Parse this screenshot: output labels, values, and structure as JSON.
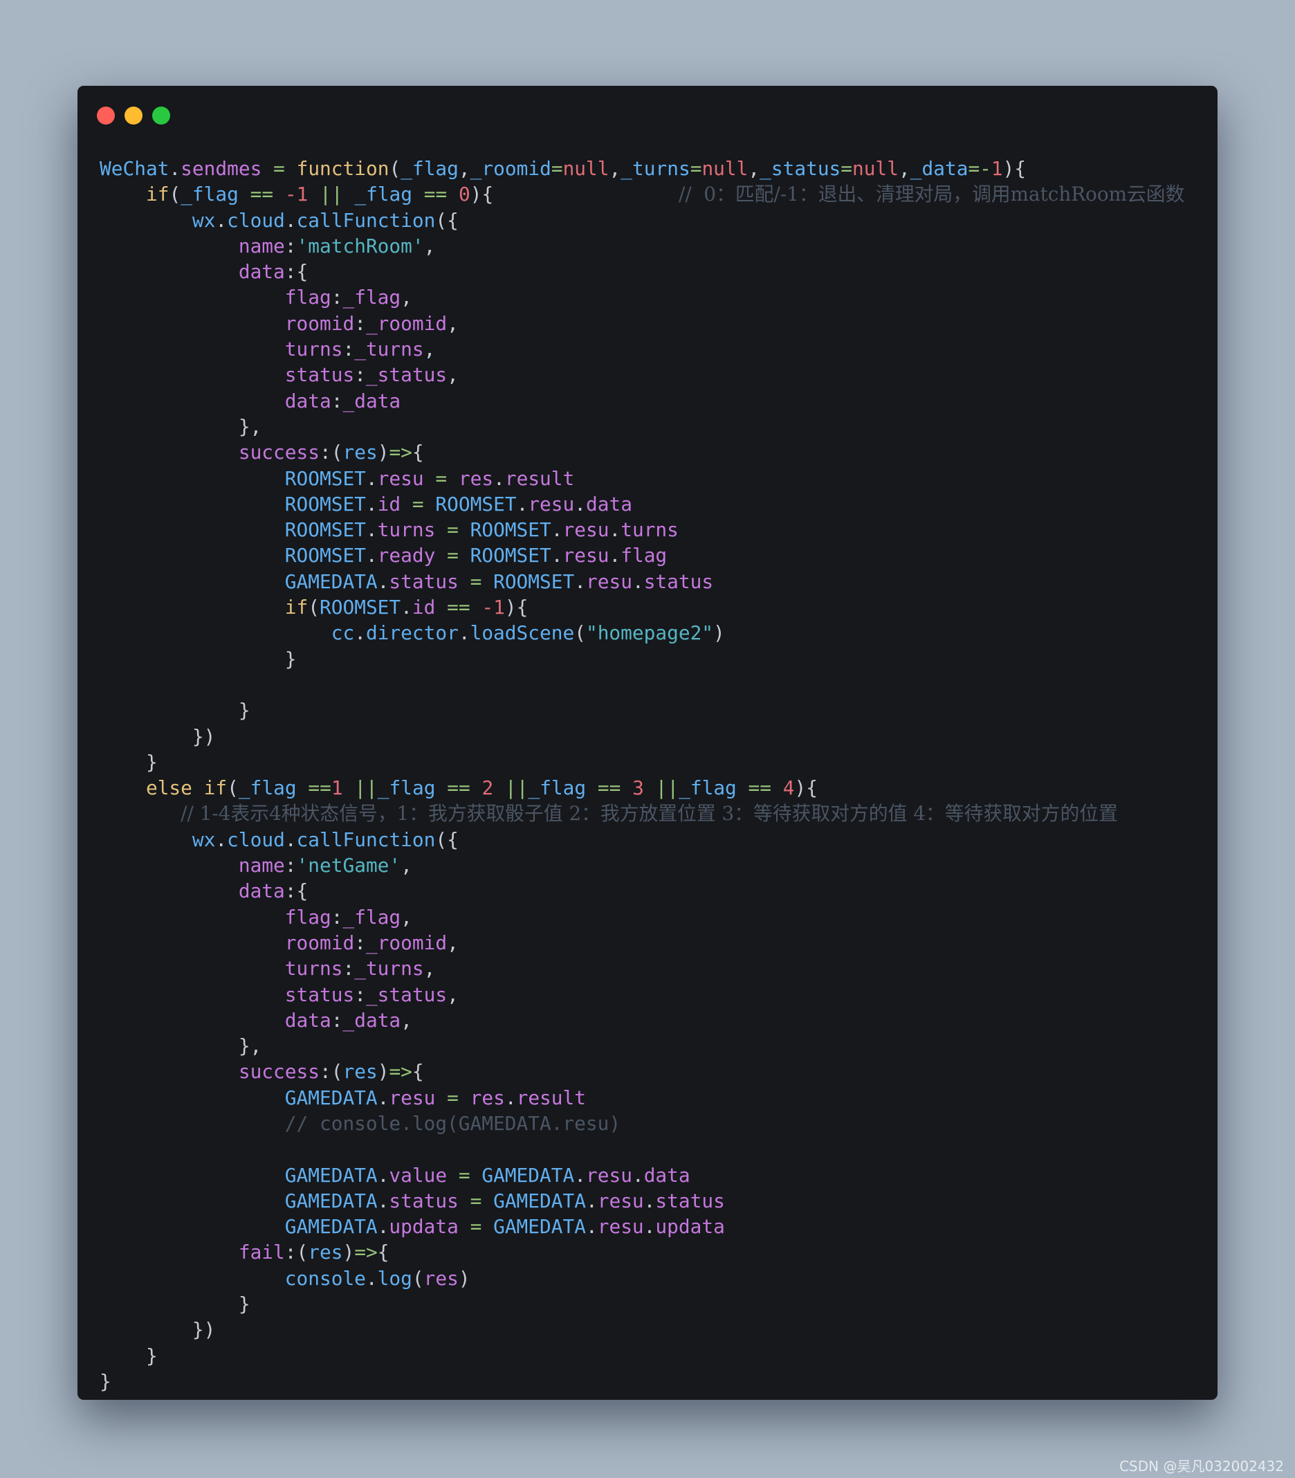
{
  "window": {
    "traffic_lights": [
      {
        "name": "close",
        "color": "#fe5f57"
      },
      {
        "name": "minimize",
        "color": "#febc2e"
      },
      {
        "name": "maximize",
        "color": "#28c840"
      }
    ]
  },
  "colors": {
    "background": "#a8b5c3",
    "window": "#16181c",
    "default": "#c8ccd4",
    "keyword": "#e5c07b",
    "func": "#e5c07b",
    "ident": "#61afef",
    "prop": "#c678dd",
    "number": "#e06c75",
    "string": "#56b6c2",
    "op": "#98c379",
    "comment": "#4b5563"
  },
  "code_lines": [
    [
      [
        "ident",
        "WeChat"
      ],
      [
        "text",
        "."
      ],
      [
        "prop",
        "sendmes"
      ],
      [
        "text",
        " "
      ],
      [
        "op",
        "="
      ],
      [
        "text",
        " "
      ],
      [
        "func",
        "function"
      ],
      [
        "text",
        "("
      ],
      [
        "ident",
        "_flag"
      ],
      [
        "text",
        ","
      ],
      [
        "ident",
        "_roomid"
      ],
      [
        "op",
        "="
      ],
      [
        "number",
        "null"
      ],
      [
        "text",
        ","
      ],
      [
        "ident",
        "_turns"
      ],
      [
        "op",
        "="
      ],
      [
        "number",
        "null"
      ],
      [
        "text",
        ","
      ],
      [
        "ident",
        "_status"
      ],
      [
        "op",
        "="
      ],
      [
        "number",
        "null"
      ],
      [
        "text",
        ","
      ],
      [
        "ident",
        "_data"
      ],
      [
        "op",
        "=-"
      ],
      [
        "number",
        "1"
      ],
      [
        "text",
        "){"
      ]
    ],
    [
      [
        "text",
        "    "
      ],
      [
        "keyword",
        "if"
      ],
      [
        "text",
        "("
      ],
      [
        "ident",
        "_flag"
      ],
      [
        "text",
        " "
      ],
      [
        "op",
        "=="
      ],
      [
        "text",
        " "
      ],
      [
        "number",
        "-1"
      ],
      [
        "text",
        " "
      ],
      [
        "op",
        "||"
      ],
      [
        "text",
        " "
      ],
      [
        "ident",
        "_flag"
      ],
      [
        "text",
        " "
      ],
      [
        "op",
        "=="
      ],
      [
        "text",
        " "
      ],
      [
        "number",
        "0"
      ],
      [
        "text",
        "){                "
      ],
      [
        "comment",
        "//  0：匹配/-1：退出、清理对局，调用matchRoom云函数"
      ]
    ],
    [
      [
        "text",
        "        "
      ],
      [
        "ident",
        "wx"
      ],
      [
        "text",
        "."
      ],
      [
        "ident",
        "cloud"
      ],
      [
        "text",
        "."
      ],
      [
        "ident",
        "callFunction"
      ],
      [
        "text",
        "({"
      ]
    ],
    [
      [
        "text",
        "            "
      ],
      [
        "prop",
        "name"
      ],
      [
        "text",
        ":"
      ],
      [
        "string",
        "'matchRoom'"
      ],
      [
        "text",
        ","
      ]
    ],
    [
      [
        "text",
        "            "
      ],
      [
        "prop",
        "data"
      ],
      [
        "text",
        ":{"
      ]
    ],
    [
      [
        "text",
        "                "
      ],
      [
        "prop",
        "flag"
      ],
      [
        "text",
        ":"
      ],
      [
        "prop",
        "_flag"
      ],
      [
        "text",
        ","
      ]
    ],
    [
      [
        "text",
        "                "
      ],
      [
        "prop",
        "roomid"
      ],
      [
        "text",
        ":"
      ],
      [
        "prop",
        "_roomid"
      ],
      [
        "text",
        ","
      ]
    ],
    [
      [
        "text",
        "                "
      ],
      [
        "prop",
        "turns"
      ],
      [
        "text",
        ":"
      ],
      [
        "prop",
        "_turns"
      ],
      [
        "text",
        ","
      ]
    ],
    [
      [
        "text",
        "                "
      ],
      [
        "prop",
        "status"
      ],
      [
        "text",
        ":"
      ],
      [
        "prop",
        "_status"
      ],
      [
        "text",
        ","
      ]
    ],
    [
      [
        "text",
        "                "
      ],
      [
        "prop",
        "data"
      ],
      [
        "text",
        ":"
      ],
      [
        "prop",
        "_data"
      ]
    ],
    [
      [
        "text",
        "            },"
      ]
    ],
    [
      [
        "text",
        "            "
      ],
      [
        "prop",
        "success"
      ],
      [
        "text",
        ":("
      ],
      [
        "ident",
        "res"
      ],
      [
        "text",
        ")"
      ],
      [
        "op",
        "=>"
      ],
      [
        "text",
        "{"
      ]
    ],
    [
      [
        "text",
        "                "
      ],
      [
        "ident",
        "ROOMSET"
      ],
      [
        "text",
        "."
      ],
      [
        "prop",
        "resu"
      ],
      [
        "text",
        " "
      ],
      [
        "op",
        "="
      ],
      [
        "text",
        " "
      ],
      [
        "prop",
        "res"
      ],
      [
        "text",
        "."
      ],
      [
        "prop",
        "result"
      ]
    ],
    [
      [
        "text",
        "                "
      ],
      [
        "ident",
        "ROOMSET"
      ],
      [
        "text",
        "."
      ],
      [
        "prop",
        "id"
      ],
      [
        "text",
        " "
      ],
      [
        "op",
        "="
      ],
      [
        "text",
        " "
      ],
      [
        "ident",
        "ROOMSET"
      ],
      [
        "text",
        "."
      ],
      [
        "prop",
        "resu"
      ],
      [
        "text",
        "."
      ],
      [
        "prop",
        "data"
      ]
    ],
    [
      [
        "text",
        "                "
      ],
      [
        "ident",
        "ROOMSET"
      ],
      [
        "text",
        "."
      ],
      [
        "prop",
        "turns"
      ],
      [
        "text",
        " "
      ],
      [
        "op",
        "="
      ],
      [
        "text",
        " "
      ],
      [
        "ident",
        "ROOMSET"
      ],
      [
        "text",
        "."
      ],
      [
        "prop",
        "resu"
      ],
      [
        "text",
        "."
      ],
      [
        "prop",
        "turns"
      ]
    ],
    [
      [
        "text",
        "                "
      ],
      [
        "ident",
        "ROOMSET"
      ],
      [
        "text",
        "."
      ],
      [
        "prop",
        "ready"
      ],
      [
        "text",
        " "
      ],
      [
        "op",
        "="
      ],
      [
        "text",
        " "
      ],
      [
        "ident",
        "ROOMSET"
      ],
      [
        "text",
        "."
      ],
      [
        "prop",
        "resu"
      ],
      [
        "text",
        "."
      ],
      [
        "prop",
        "flag"
      ]
    ],
    [
      [
        "text",
        "                "
      ],
      [
        "ident",
        "GAMEDATA"
      ],
      [
        "text",
        "."
      ],
      [
        "prop",
        "status"
      ],
      [
        "text",
        " "
      ],
      [
        "op",
        "="
      ],
      [
        "text",
        " "
      ],
      [
        "ident",
        "ROOMSET"
      ],
      [
        "text",
        "."
      ],
      [
        "prop",
        "resu"
      ],
      [
        "text",
        "."
      ],
      [
        "prop",
        "status"
      ]
    ],
    [
      [
        "text",
        "                "
      ],
      [
        "keyword",
        "if"
      ],
      [
        "text",
        "("
      ],
      [
        "ident",
        "ROOMSET"
      ],
      [
        "text",
        "."
      ],
      [
        "prop",
        "id"
      ],
      [
        "text",
        " "
      ],
      [
        "op",
        "=="
      ],
      [
        "text",
        " "
      ],
      [
        "number",
        "-1"
      ],
      [
        "text",
        "){"
      ]
    ],
    [
      [
        "text",
        "                    "
      ],
      [
        "ident",
        "cc"
      ],
      [
        "text",
        "."
      ],
      [
        "ident",
        "director"
      ],
      [
        "text",
        "."
      ],
      [
        "ident",
        "loadScene"
      ],
      [
        "text",
        "("
      ],
      [
        "string",
        "\"homepage2\""
      ],
      [
        "text",
        ")"
      ]
    ],
    [
      [
        "text",
        "                }"
      ]
    ],
    [
      [
        "text",
        ""
      ]
    ],
    [
      [
        "text",
        "            }"
      ]
    ],
    [
      [
        "text",
        "        })"
      ]
    ],
    [
      [
        "text",
        "    }"
      ]
    ],
    [
      [
        "text",
        "    "
      ],
      [
        "keyword",
        "else"
      ],
      [
        "text",
        " "
      ],
      [
        "keyword",
        "if"
      ],
      [
        "text",
        "("
      ],
      [
        "ident",
        "_flag"
      ],
      [
        "text",
        " "
      ],
      [
        "op",
        "=="
      ],
      [
        "number",
        "1"
      ],
      [
        "text",
        " "
      ],
      [
        "op",
        "||"
      ],
      [
        "ident",
        "_flag"
      ],
      [
        "text",
        " "
      ],
      [
        "op",
        "=="
      ],
      [
        "text",
        " "
      ],
      [
        "number",
        "2"
      ],
      [
        "text",
        " "
      ],
      [
        "op",
        "||"
      ],
      [
        "ident",
        "_flag"
      ],
      [
        "text",
        " "
      ],
      [
        "op",
        "=="
      ],
      [
        "text",
        " "
      ],
      [
        "number",
        "3"
      ],
      [
        "text",
        " "
      ],
      [
        "op",
        "||"
      ],
      [
        "ident",
        "_flag"
      ],
      [
        "text",
        " "
      ],
      [
        "op",
        "=="
      ],
      [
        "text",
        " "
      ],
      [
        "number",
        "4"
      ],
      [
        "text",
        "){"
      ]
    ],
    [
      [
        "text",
        "       "
      ],
      [
        "comment",
        "// 1-4表示4种状态信号，1：我方获取骰子值 2：我方放置位置 3：等待获取对方的值 4：等待获取对方的位置"
      ]
    ],
    [
      [
        "text",
        "        "
      ],
      [
        "ident",
        "wx"
      ],
      [
        "text",
        "."
      ],
      [
        "ident",
        "cloud"
      ],
      [
        "text",
        "."
      ],
      [
        "ident",
        "callFunction"
      ],
      [
        "text",
        "({"
      ]
    ],
    [
      [
        "text",
        "            "
      ],
      [
        "prop",
        "name"
      ],
      [
        "text",
        ":"
      ],
      [
        "string",
        "'netGame'"
      ],
      [
        "text",
        ","
      ]
    ],
    [
      [
        "text",
        "            "
      ],
      [
        "prop",
        "data"
      ],
      [
        "text",
        ":{"
      ]
    ],
    [
      [
        "text",
        "                "
      ],
      [
        "prop",
        "flag"
      ],
      [
        "text",
        ":"
      ],
      [
        "prop",
        "_flag"
      ],
      [
        "text",
        ","
      ]
    ],
    [
      [
        "text",
        "                "
      ],
      [
        "prop",
        "roomid"
      ],
      [
        "text",
        ":"
      ],
      [
        "prop",
        "_roomid"
      ],
      [
        "text",
        ","
      ]
    ],
    [
      [
        "text",
        "                "
      ],
      [
        "prop",
        "turns"
      ],
      [
        "text",
        ":"
      ],
      [
        "prop",
        "_turns"
      ],
      [
        "text",
        ","
      ]
    ],
    [
      [
        "text",
        "                "
      ],
      [
        "prop",
        "status"
      ],
      [
        "text",
        ":"
      ],
      [
        "prop",
        "_status"
      ],
      [
        "text",
        ","
      ]
    ],
    [
      [
        "text",
        "                "
      ],
      [
        "prop",
        "data"
      ],
      [
        "text",
        ":"
      ],
      [
        "prop",
        "_data"
      ],
      [
        "text",
        ","
      ]
    ],
    [
      [
        "text",
        "            },"
      ]
    ],
    [
      [
        "text",
        "            "
      ],
      [
        "prop",
        "success"
      ],
      [
        "text",
        ":("
      ],
      [
        "ident",
        "res"
      ],
      [
        "text",
        ")"
      ],
      [
        "op",
        "=>"
      ],
      [
        "text",
        "{"
      ]
    ],
    [
      [
        "text",
        "                "
      ],
      [
        "ident",
        "GAMEDATA"
      ],
      [
        "text",
        "."
      ],
      [
        "prop",
        "resu"
      ],
      [
        "text",
        " "
      ],
      [
        "op",
        "="
      ],
      [
        "text",
        " "
      ],
      [
        "prop",
        "res"
      ],
      [
        "text",
        "."
      ],
      [
        "prop",
        "result"
      ]
    ],
    [
      [
        "text",
        "                "
      ],
      [
        "comment",
        "// console.log(GAMEDATA.resu)"
      ]
    ],
    [
      [
        "text",
        ""
      ]
    ],
    [
      [
        "text",
        "                "
      ],
      [
        "ident",
        "GAMEDATA"
      ],
      [
        "text",
        "."
      ],
      [
        "prop",
        "value"
      ],
      [
        "text",
        " "
      ],
      [
        "op",
        "="
      ],
      [
        "text",
        " "
      ],
      [
        "ident",
        "GAMEDATA"
      ],
      [
        "text",
        "."
      ],
      [
        "prop",
        "resu"
      ],
      [
        "text",
        "."
      ],
      [
        "prop",
        "data"
      ]
    ],
    [
      [
        "text",
        "                "
      ],
      [
        "ident",
        "GAMEDATA"
      ],
      [
        "text",
        "."
      ],
      [
        "prop",
        "status"
      ],
      [
        "text",
        " "
      ],
      [
        "op",
        "="
      ],
      [
        "text",
        " "
      ],
      [
        "ident",
        "GAMEDATA"
      ],
      [
        "text",
        "."
      ],
      [
        "prop",
        "resu"
      ],
      [
        "text",
        "."
      ],
      [
        "prop",
        "status"
      ]
    ],
    [
      [
        "text",
        "                "
      ],
      [
        "ident",
        "GAMEDATA"
      ],
      [
        "text",
        "."
      ],
      [
        "prop",
        "updata"
      ],
      [
        "text",
        " "
      ],
      [
        "op",
        "="
      ],
      [
        "text",
        " "
      ],
      [
        "ident",
        "GAMEDATA"
      ],
      [
        "text",
        "."
      ],
      [
        "prop",
        "resu"
      ],
      [
        "text",
        "."
      ],
      [
        "prop",
        "updata"
      ]
    ],
    [
      [
        "text",
        "            "
      ],
      [
        "prop",
        "fail"
      ],
      [
        "text",
        ":("
      ],
      [
        "ident",
        "res"
      ],
      [
        "text",
        ")"
      ],
      [
        "op",
        "=>"
      ],
      [
        "text",
        "{"
      ]
    ],
    [
      [
        "text",
        "                "
      ],
      [
        "ident",
        "console"
      ],
      [
        "text",
        "."
      ],
      [
        "ident",
        "log"
      ],
      [
        "text",
        "("
      ],
      [
        "prop",
        "res"
      ],
      [
        "text",
        ")"
      ]
    ],
    [
      [
        "text",
        "            }"
      ]
    ],
    [
      [
        "text",
        "        })"
      ]
    ],
    [
      [
        "text",
        "    }"
      ]
    ],
    [
      [
        "text",
        "}"
      ]
    ]
  ],
  "watermark": "CSDN @吴凡032002432"
}
